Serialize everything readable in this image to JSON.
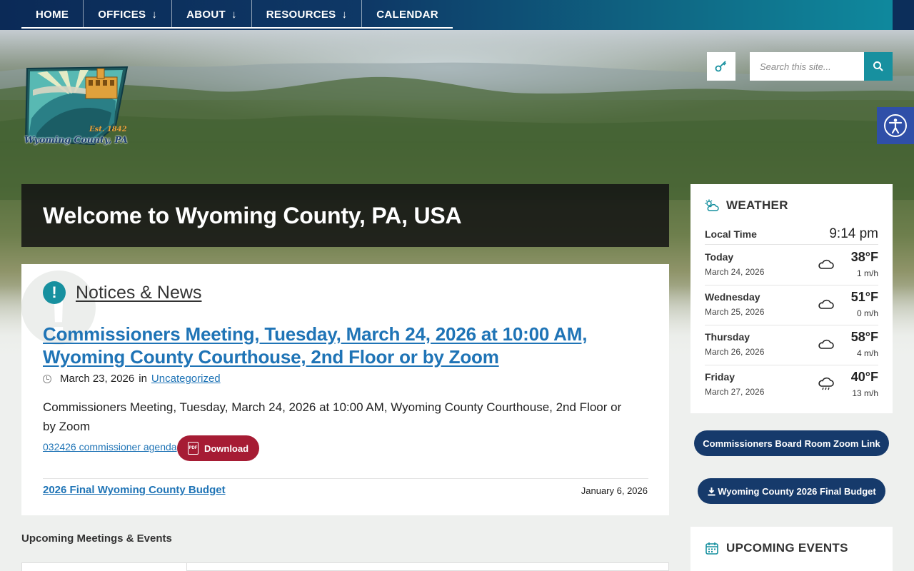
{
  "nav": {
    "items": [
      {
        "label": "HOME",
        "dropdown": false
      },
      {
        "label": "OFFICES",
        "dropdown": true
      },
      {
        "label": "ABOUT",
        "dropdown": true
      },
      {
        "label": "RESOURCES",
        "dropdown": true
      },
      {
        "label": "CALENDAR",
        "dropdown": false
      }
    ],
    "dropdown_arrow": "↓"
  },
  "logo": {
    "name": "Wyoming County, PA",
    "est": "Est. 1842"
  },
  "search": {
    "placeholder": "Search this site..."
  },
  "welcome": {
    "title": "Welcome to Wyoming County, PA, USA"
  },
  "notices": {
    "heading": "Notices & News",
    "article": {
      "title": "Commissioners Meeting, Tuesday, March 24, 2026 at 10:00 AM, Wyoming County Courthouse, 2nd Floor or by Zoom",
      "date": "March 23, 2026",
      "in_label": "in",
      "category": "Uncategorized",
      "excerpt": "Commissioners Meeting, Tuesday, March 24, 2026 at 10:00 AM, Wyoming County Courthouse, 2nd Floor or by Zoom",
      "attachment": "032426 commissioner agenda",
      "download_label": "Download"
    },
    "secondary": {
      "title": "2026 Final Wyoming County Budget",
      "date": "January 6, 2026"
    }
  },
  "upcoming": {
    "label": "Upcoming Meetings & Events"
  },
  "weather": {
    "heading": "WEATHER",
    "local_time_label": "Local Time",
    "local_time": "9:14 pm",
    "days": [
      {
        "day": "Today",
        "date": "March 24, 2026",
        "temp": "38°F",
        "wind": "1 m/h",
        "icon": "cloud-icon"
      },
      {
        "day": "Wednesday",
        "date": "March 25, 2026",
        "temp": "51°F",
        "wind": "0 m/h",
        "icon": "cloud-icon"
      },
      {
        "day": "Thursday",
        "date": "March 26, 2026",
        "temp": "58°F",
        "wind": "4 m/h",
        "icon": "cloud-icon"
      },
      {
        "day": "Friday",
        "date": "March 27, 2026",
        "temp": "40°F",
        "wind": "13 m/h",
        "icon": "rain-cloud-icon"
      }
    ]
  },
  "buttons": {
    "zoom_link": "Commissioners Board Room Zoom Link",
    "budget": "Wyoming County 2026 Final Budget"
  },
  "events": {
    "heading": "UPCOMING EVENTS"
  },
  "colors": {
    "nav_dark": "#0b2a57",
    "teal": "#17909f",
    "link": "#1f74b6",
    "download": "#a61c34",
    "pill": "#163a6b",
    "a11y": "#2f4fa8"
  }
}
